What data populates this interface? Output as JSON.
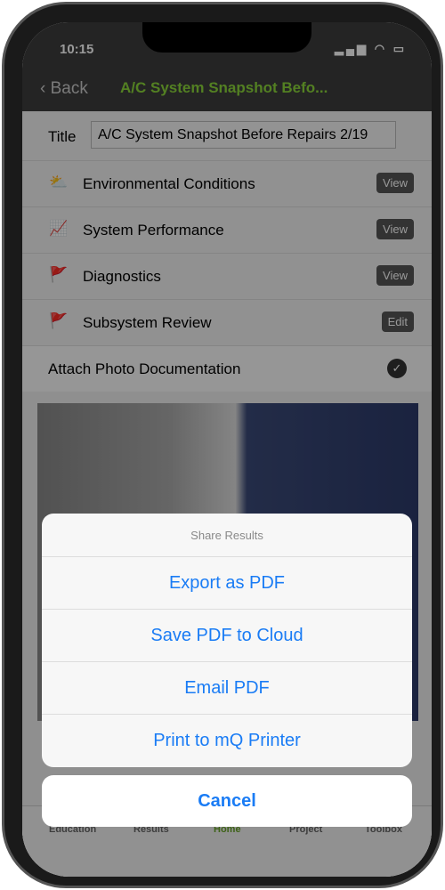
{
  "status": {
    "time": "10:15"
  },
  "nav": {
    "back": "Back",
    "title": "A/C System Snapshot Befo..."
  },
  "form": {
    "title_label": "Title",
    "title_value": "A/C System Snapshot Before Repairs 2/19"
  },
  "rows": [
    {
      "icon": "cloud-sun-icon",
      "glyph": "⛅",
      "label": "Environmental Conditions",
      "button": "View"
    },
    {
      "icon": "chart-line-icon",
      "glyph": "📈",
      "label": "System Performance",
      "button": "View"
    },
    {
      "icon": "flag-icon",
      "glyph": "🚩",
      "label": "Diagnostics",
      "button": "View"
    },
    {
      "icon": "flag-icon",
      "glyph": "🚩",
      "label": "Subsystem Review",
      "button": "Edit"
    }
  ],
  "attach": {
    "label": "Attach Photo Documentation",
    "checked": true
  },
  "tabs": [
    "Education",
    "Results",
    "Home",
    "Project",
    "Toolbox"
  ],
  "active_tab": "Home",
  "sheet": {
    "title": "Share Results",
    "items": [
      "Export as PDF",
      "Save PDF to Cloud",
      "Email PDF",
      "Print to mQ Printer"
    ],
    "cancel": "Cancel"
  },
  "colors": {
    "accent": "#1a7cf5",
    "brand": "#8ad53a"
  }
}
